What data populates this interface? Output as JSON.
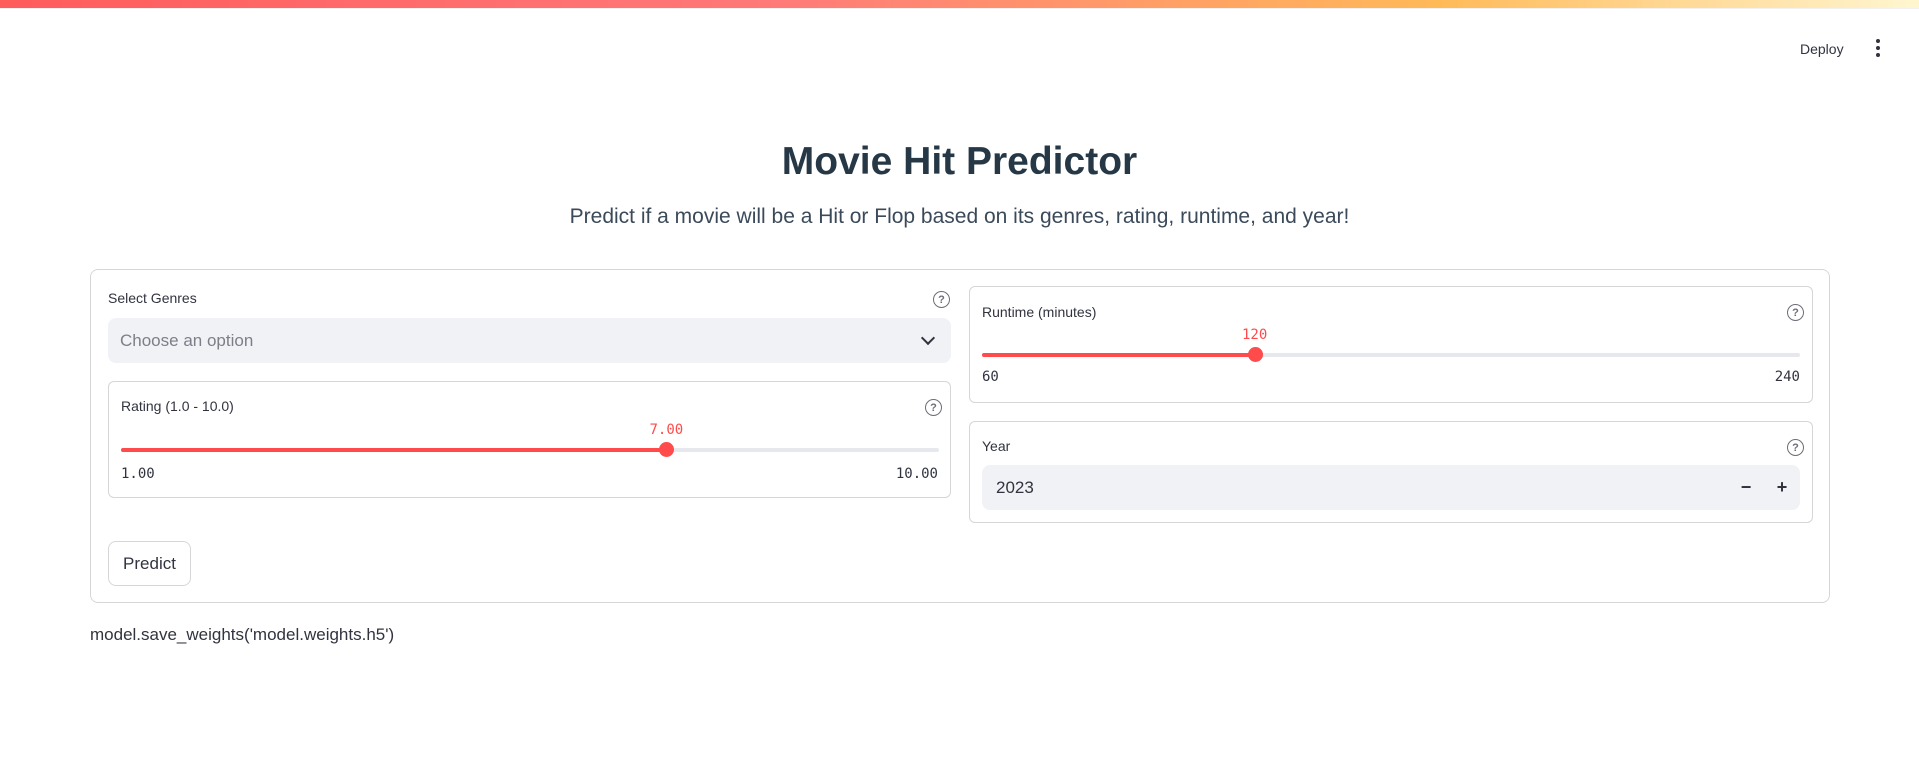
{
  "header": {
    "deploy_label": "Deploy",
    "menu_icon": "more-vertical-icon"
  },
  "main": {
    "title": "Movie Hit Predictor",
    "subtitle": "Predict if a movie will be a Hit or Flop based on its genres, rating, runtime, and year!"
  },
  "form": {
    "genres": {
      "label": "Select Genres",
      "placeholder": "Choose an option",
      "help_icon": "question-circle-icon",
      "dropdown_icon": "chevron-down-icon"
    },
    "rating": {
      "label": "Rating (1.0 - 10.0)",
      "value": "7.00",
      "min": "1.00",
      "max": "10.00",
      "fraction": 0.6667,
      "help_icon": "question-circle-icon"
    },
    "runtime": {
      "label": "Runtime (minutes)",
      "value": "120",
      "min": "60",
      "max": "240",
      "fraction": 0.3333,
      "help_icon": "question-circle-icon"
    },
    "year": {
      "label": "Year",
      "value": "2023",
      "decrement": "−",
      "increment": "+",
      "help_icon": "question-circle-icon"
    },
    "predict_label": "Predict"
  },
  "output": {
    "text": "model.save_weights('model.weights.h5')"
  },
  "colors": {
    "accent": "#ff4b4b",
    "title": "#263846",
    "input_bg": "#f0f2f6"
  }
}
